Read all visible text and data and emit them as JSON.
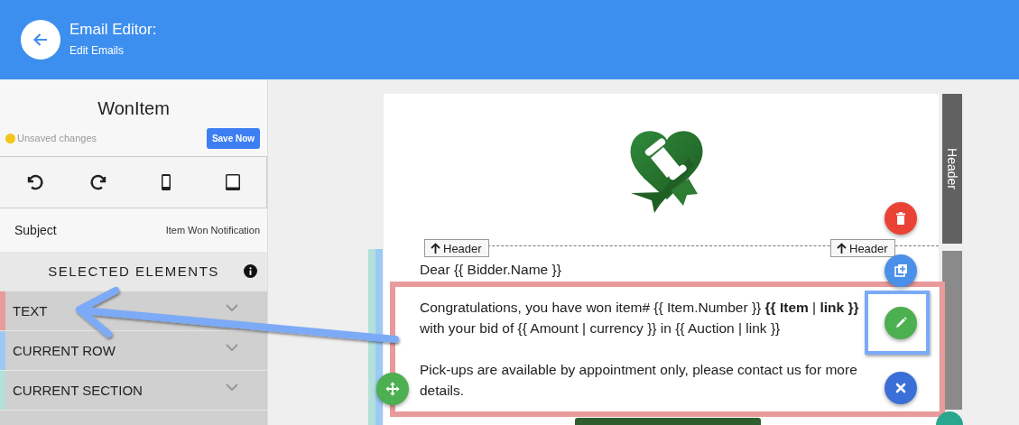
{
  "header": {
    "title": "Email Editor:",
    "subtitle": "Edit Emails"
  },
  "sidebar": {
    "template_name": "WonItem",
    "status": {
      "text": "Unsaved changes",
      "saved": false
    },
    "save_button": "Save Now",
    "toolbar": [
      {
        "kind": "undo"
      },
      {
        "kind": "redo"
      },
      {
        "kind": "phone"
      },
      {
        "kind": "tablet"
      }
    ],
    "subject": {
      "label": "Subject",
      "value": "Item Won Notification"
    },
    "selected_elements": {
      "title": "SELECTED ELEMENTS",
      "items": [
        {
          "label": "TEXT",
          "color": "#e99a9a"
        },
        {
          "label": "CURRENT ROW",
          "color": "#9ccaf5"
        },
        {
          "label": "CURRENT SECTION",
          "color": "#b3e0db"
        }
      ]
    }
  },
  "email": {
    "section_tab": "Header",
    "header_tags": [
      "Header",
      "Header"
    ],
    "greeting": "Dear {{ Bidder.Name }}",
    "paragraphs": [
      "Congratulations, you have won item# {{ Item.Number }} **{{ Item** | **link }}** with your bid of {{ Amount | currency }} in {{ Auction | link }}",
      "Pick-ups are available by appointment only, please contact us for more details."
    ],
    "actions": [
      {
        "kind": "delete"
      },
      {
        "kind": "duplicate"
      },
      {
        "kind": "edit"
      },
      {
        "kind": "close"
      },
      {
        "kind": "move"
      }
    ]
  }
}
